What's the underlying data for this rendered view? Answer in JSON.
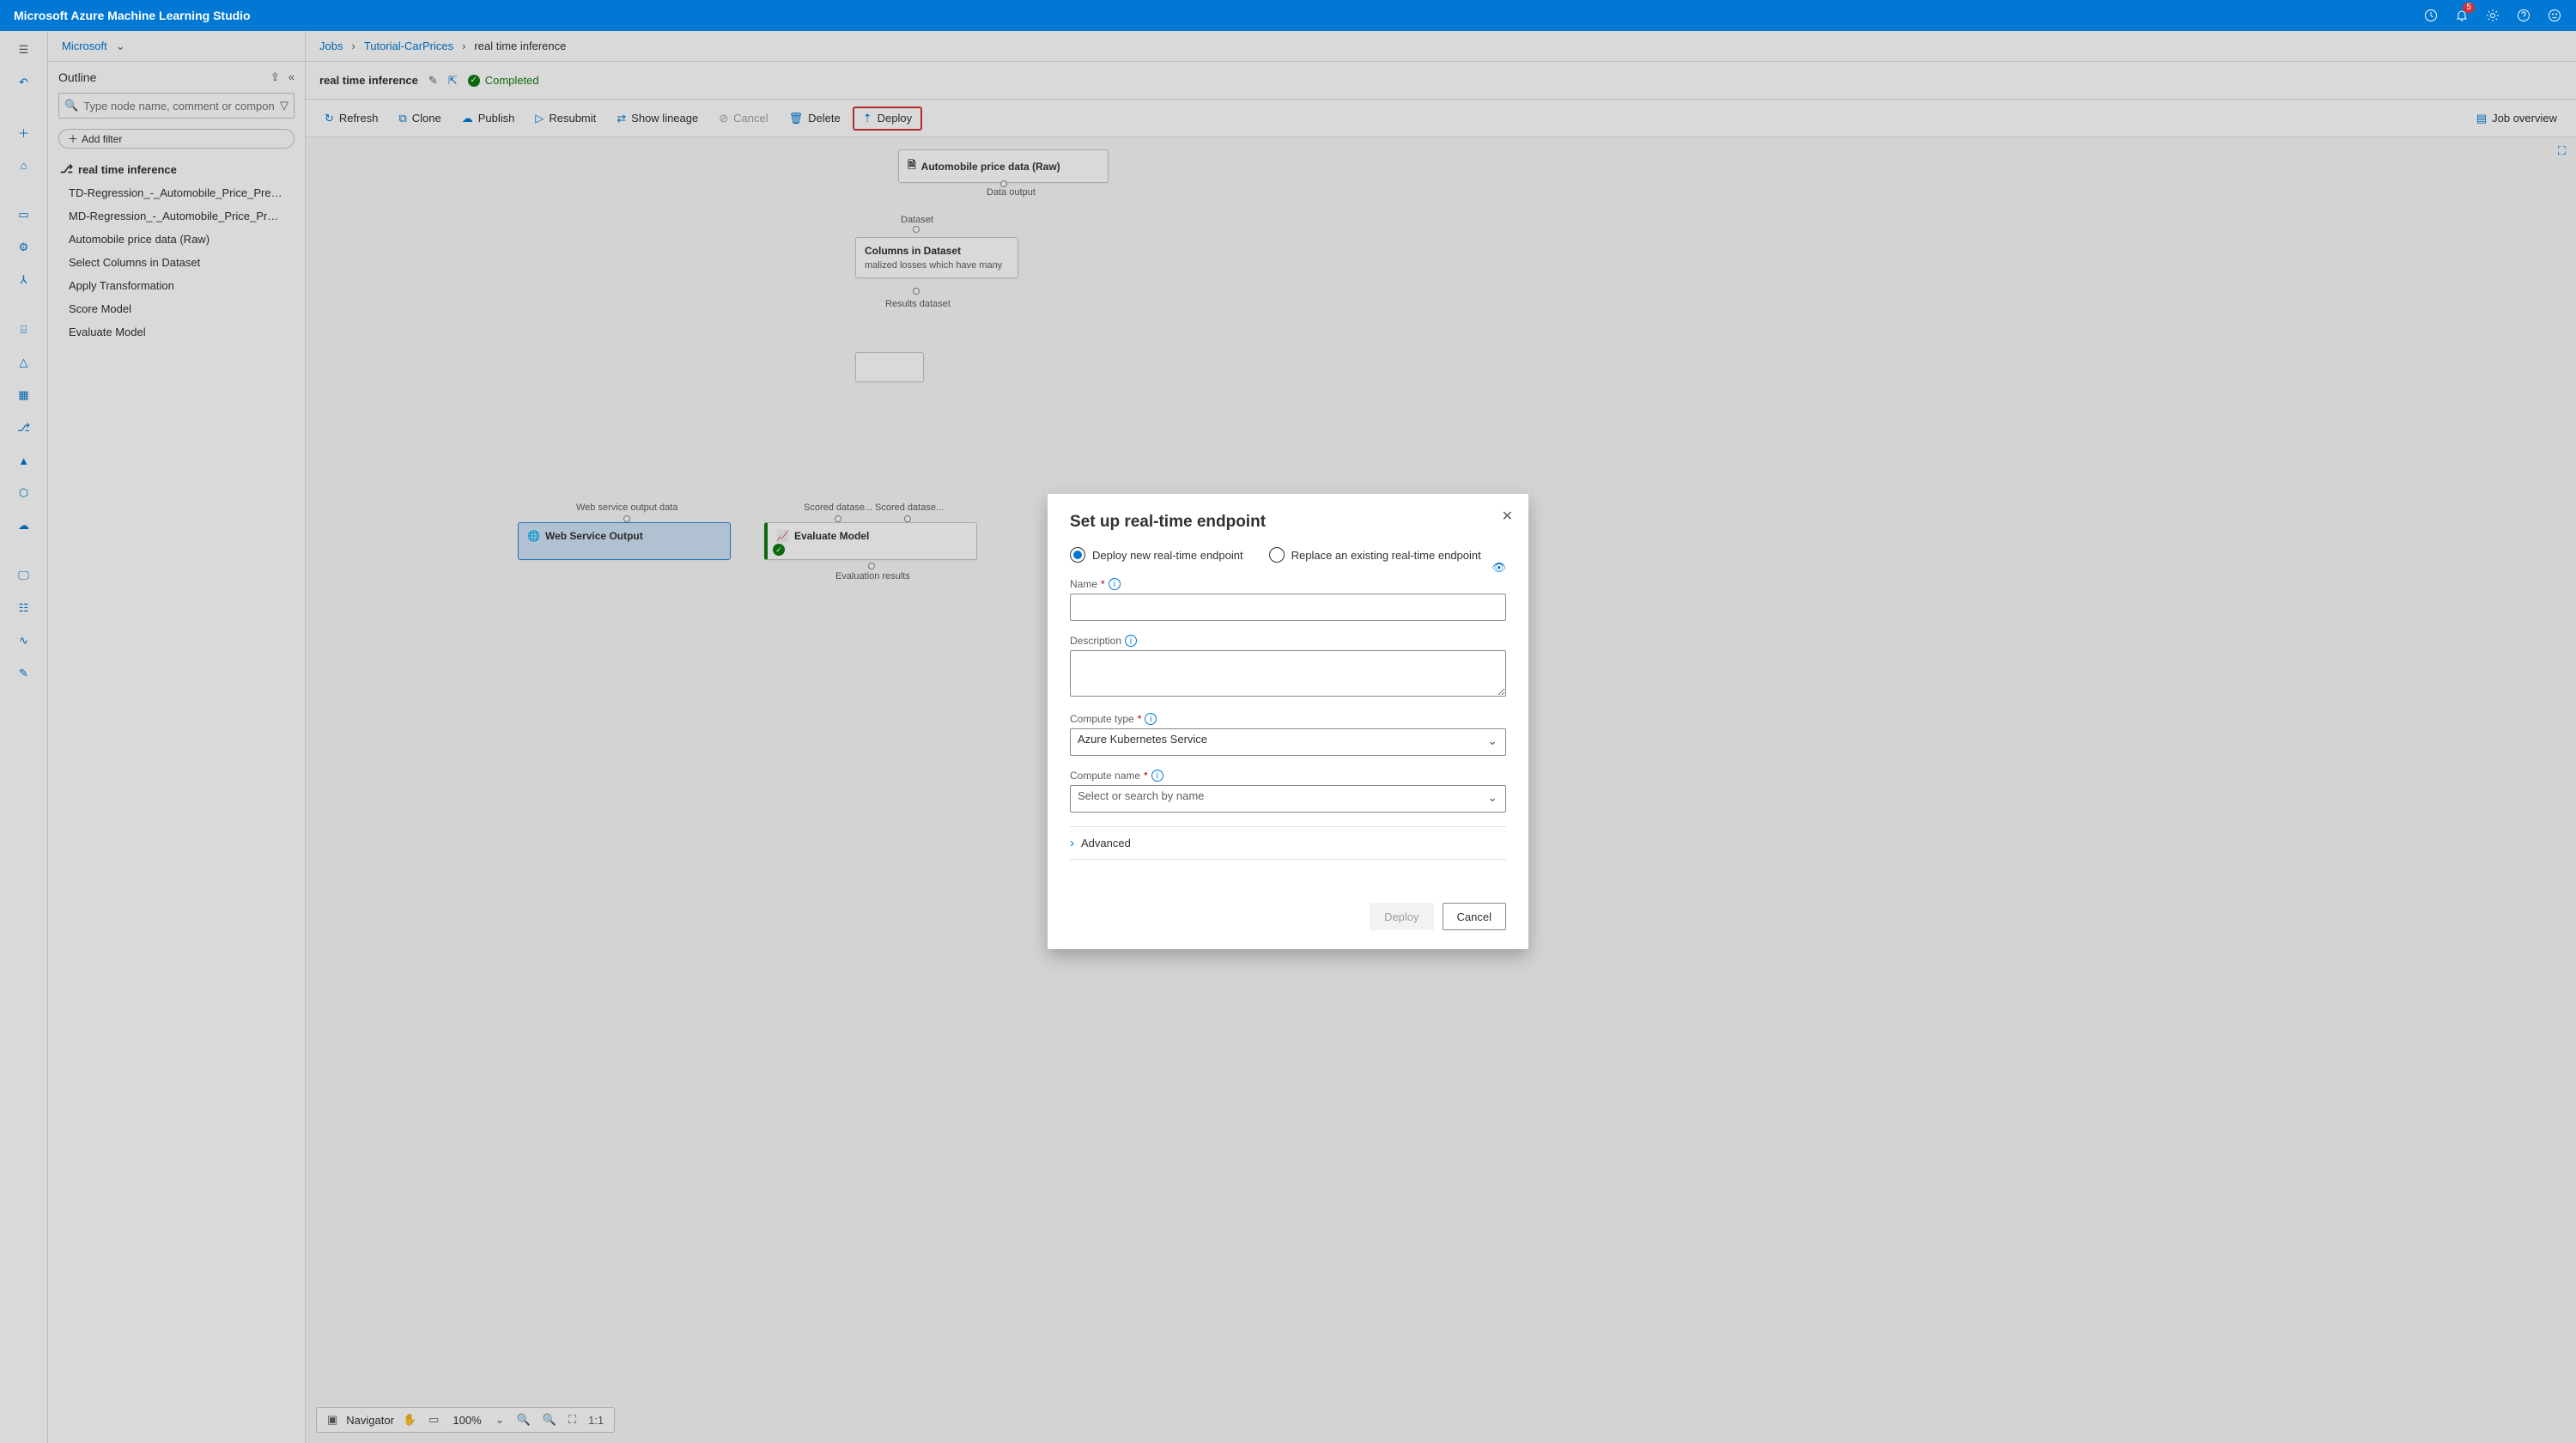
{
  "topbar": {
    "title": "Microsoft Azure Machine Learning Studio",
    "notif_count": "5"
  },
  "breadcrumb": {
    "root": "Microsoft",
    "jobs": "Jobs",
    "tutorial": "Tutorial-CarPrices",
    "current": "real time inference"
  },
  "outline": {
    "title": "Outline",
    "search_placeholder": "Type node name, comment or compon",
    "add_filter": "Add filter",
    "root": "real time inference",
    "items": [
      "TD-Regression_-_Automobile_Price_Predict...",
      "MD-Regression_-_Automobile_Price_Predic...",
      "Automobile price data (Raw)",
      "Select Columns in Dataset",
      "Apply Transformation",
      "Score Model",
      "Evaluate Model"
    ]
  },
  "pipeline": {
    "name": "real time inference",
    "status": "Completed"
  },
  "toolbar": {
    "refresh": "Refresh",
    "clone": "Clone",
    "publish": "Publish",
    "resubmit": "Resubmit",
    "show_lineage": "Show lineage",
    "cancel": "Cancel",
    "delete": "Delete",
    "deploy": "Deploy",
    "job_overview": "Job overview"
  },
  "canvas": {
    "auto_node": "Automobile price data (Raw)",
    "auto_port": "Data output",
    "dataset_label": "Dataset",
    "select_cols_title": "Columns in Dataset",
    "select_cols_desc": "malized losses which have many",
    "results_dataset": "Results dataset",
    "web_output_port": "Web service output data",
    "scored_l": "Scored datase...",
    "scored_r": "Scored datase...",
    "web_output": "Web Service Output",
    "evaluate": "Evaluate Model",
    "eval_results": "Evaluation results"
  },
  "bottombar": {
    "navigator": "Navigator",
    "zoom": "100%"
  },
  "modal": {
    "title": "Set up real-time endpoint",
    "radio_new": "Deploy new real-time endpoint",
    "radio_replace": "Replace an existing real-time endpoint",
    "name_label": "Name",
    "desc_label": "Description",
    "compute_type_label": "Compute type",
    "compute_type_value": "Azure Kubernetes Service",
    "compute_name_label": "Compute name",
    "compute_name_placeholder": "Select or search by name",
    "advanced": "Advanced",
    "deploy": "Deploy",
    "cancel": "Cancel"
  }
}
